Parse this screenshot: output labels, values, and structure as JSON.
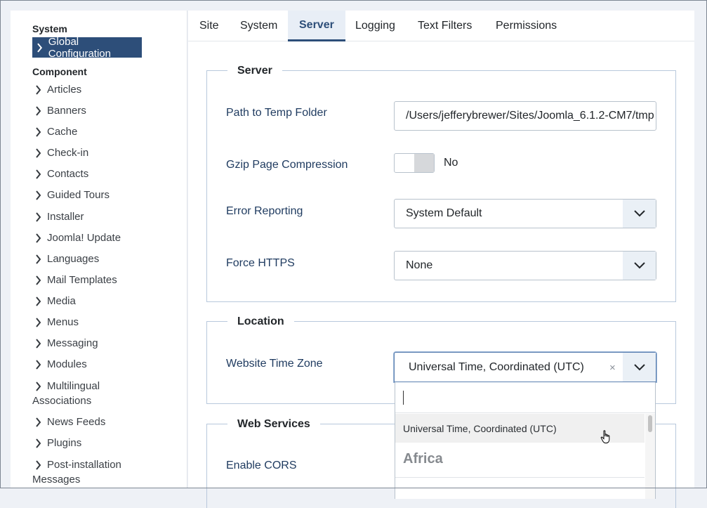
{
  "sidebar": {
    "system_heading": "System",
    "active_item": "Global Configuration",
    "component_heading": "Component",
    "items": [
      "Articles",
      "Banners",
      "Cache",
      "Check-in",
      "Contacts",
      "Guided Tours",
      "Installer",
      "Joomla! Update",
      "Languages",
      "Mail Templates",
      "Media",
      "Menus",
      "Messaging",
      "Modules"
    ],
    "multilingual": [
      "Multilingual",
      "Associations"
    ],
    "items2": [
      "News Feeds",
      "Plugins"
    ],
    "postinstall": [
      "Post-installation",
      "Messages"
    ]
  },
  "tabs": [
    "Site",
    "System",
    "Server",
    "Logging",
    "Text Filters",
    "Permissions"
  ],
  "server": {
    "legend": "Server",
    "temp_label": "Path to Temp Folder",
    "temp_value": "/Users/jefferybrewer/Sites/Joomla_6.1.2-CM7/tmp",
    "gzip_label": "Gzip Page Compression",
    "gzip_value": "No",
    "error_label": "Error Reporting",
    "error_value": "System Default",
    "https_label": "Force HTTPS",
    "https_value": "None"
  },
  "location": {
    "legend": "Location",
    "tz_label": "Website Time Zone",
    "tz_value": "Universal Time, Coordinated (UTC)",
    "clear": "×"
  },
  "dropdown": {
    "search_value": "",
    "option": "Universal Time, Coordinated (UTC)",
    "group": "Africa"
  },
  "webservices": {
    "legend": "Web Services",
    "cors_label": "Enable CORS"
  },
  "colors": {
    "accent": "#2d4e79",
    "label": "#1e3a5f"
  }
}
